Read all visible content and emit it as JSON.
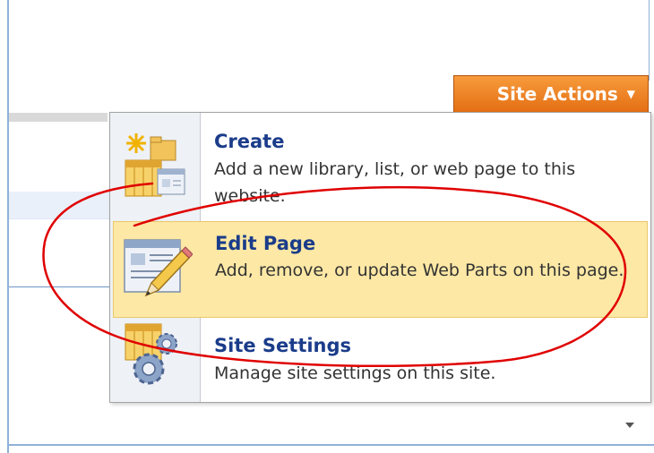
{
  "toolbar": {
    "site_actions_label": "Site Actions",
    "site_actions_arrow": "▼"
  },
  "menu": {
    "items": [
      {
        "title": "Create",
        "description": "Add a new library, list, or web page to this website.",
        "icon": "create-icon"
      },
      {
        "title": "Edit Page",
        "description": "Add, remove, or update Web Parts on this page.",
        "icon": "edit-page-icon",
        "highlighted": true
      },
      {
        "title": "Site Settings",
        "description": "Manage site settings on this site.",
        "icon": "site-settings-icon"
      }
    ]
  },
  "colors": {
    "accent_orange": "#e46f14",
    "highlight": "#fde8a5",
    "title_blue": "#1a3c8a",
    "annotation_red": "#e00000"
  }
}
